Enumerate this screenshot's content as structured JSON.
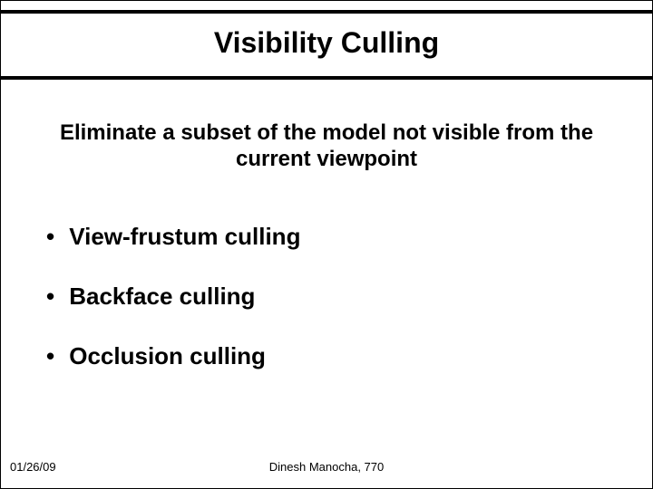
{
  "slide": {
    "title": "Visibility Culling",
    "subtitle": "Eliminate a subset of the model not visible from the current viewpoint",
    "bullets": [
      "View-frustum culling",
      "Backface culling",
      "Occlusion culling"
    ]
  },
  "footer": {
    "date": "01/26/09",
    "author": "Dinesh Manocha, 770"
  }
}
